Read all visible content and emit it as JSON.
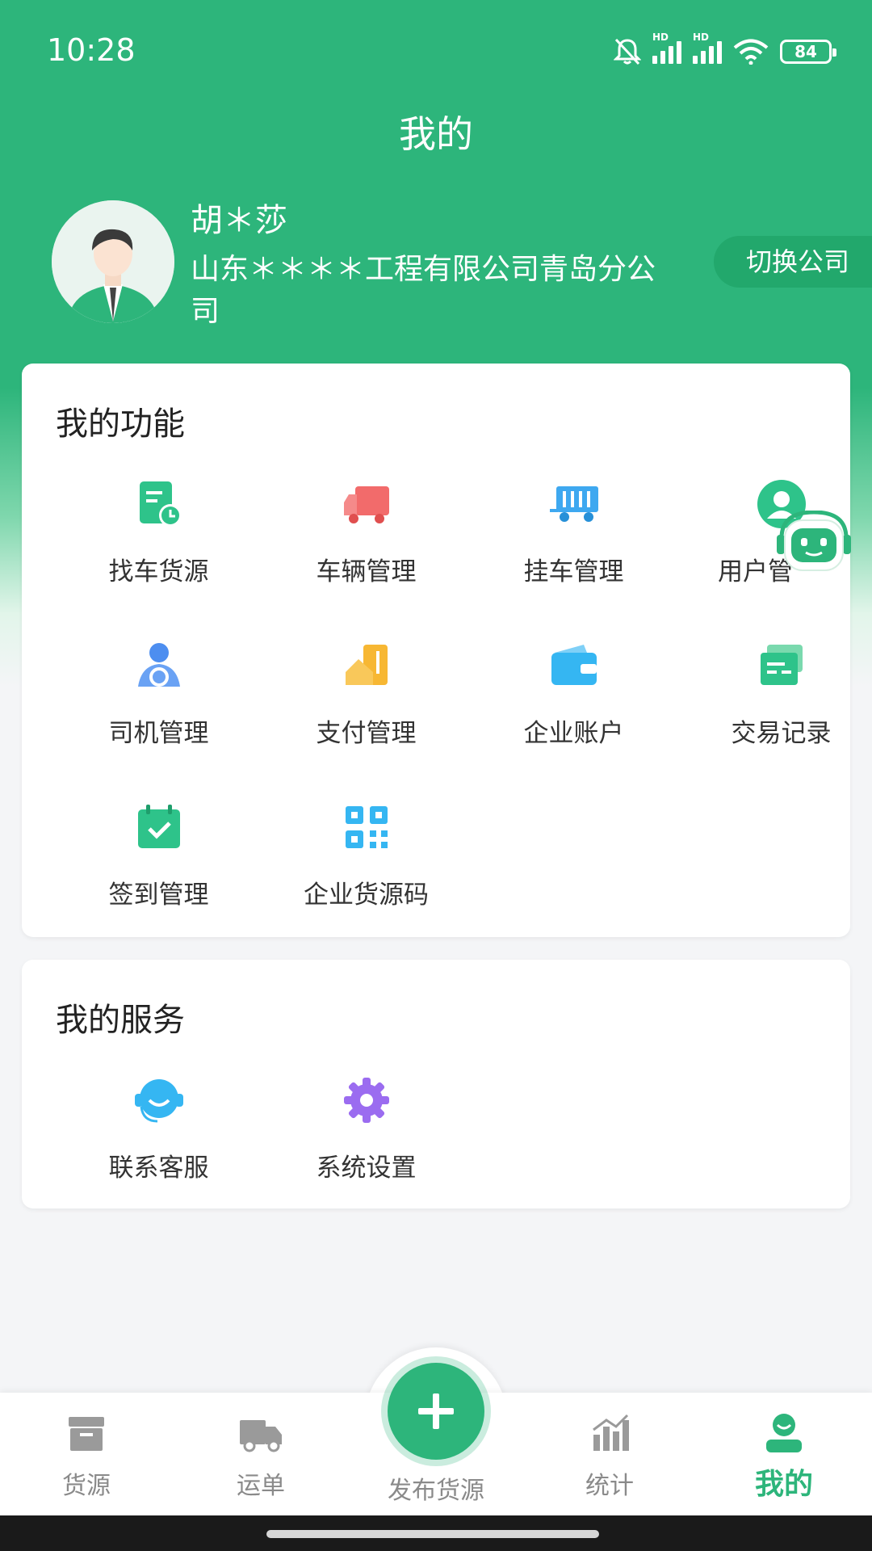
{
  "status_bar": {
    "time": "10:28",
    "battery": "84",
    "network_label": "HD",
    "icons": [
      "bell-muted-icon",
      "signal-icon",
      "signal-icon",
      "wifi-icon",
      "battery-icon"
    ]
  },
  "header": {
    "title": "我的",
    "user_name": "胡＊莎",
    "company": "山东＊＊＊＊工程有限公司青岛分公司",
    "switch_label": "切换公司"
  },
  "functions": {
    "title": "我的功能",
    "items": [
      {
        "label": "找车货源",
        "icon": "cargo-search-icon"
      },
      {
        "label": "车辆管理",
        "icon": "truck-icon"
      },
      {
        "label": "挂车管理",
        "icon": "trailer-icon"
      },
      {
        "label": "用户管",
        "icon": "user-icon"
      },
      {
        "label": "司机管理",
        "icon": "driver-icon"
      },
      {
        "label": "支付管理",
        "icon": "payment-icon"
      },
      {
        "label": "企业账户",
        "icon": "wallet-icon"
      },
      {
        "label": "交易记录",
        "icon": "transaction-record-icon"
      },
      {
        "label": "签到管理",
        "icon": "calendar-check-icon"
      },
      {
        "label": "企业货源码",
        "icon": "qr-code-icon"
      }
    ]
  },
  "services": {
    "title": "我的服务",
    "items": [
      {
        "label": "联系客服",
        "icon": "customer-service-icon"
      },
      {
        "label": "系统设置",
        "icon": "settings-gear-icon"
      }
    ]
  },
  "tabbar": {
    "tabs": [
      {
        "label": "货源",
        "icon": "box-icon",
        "active": false
      },
      {
        "label": "运单",
        "icon": "delivery-truck-icon",
        "active": false
      },
      {
        "label": "发布货源",
        "icon": "plus-icon",
        "active": false
      },
      {
        "label": "统计",
        "icon": "bar-chart-icon",
        "active": false
      },
      {
        "label": "我的",
        "icon": "profile-icon",
        "active": true
      }
    ]
  },
  "colors": {
    "brand": "#2db57b",
    "switch_button": "#22a86c",
    "background": "#f4f5f7"
  }
}
